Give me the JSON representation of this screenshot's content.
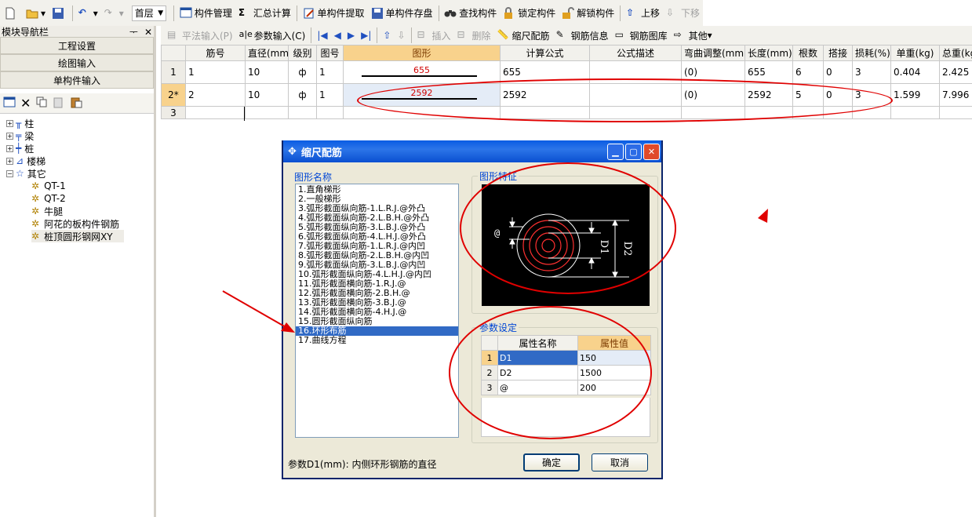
{
  "toolbar": {
    "floor": "首层",
    "items": [
      "构件管理",
      "汇总计算",
      "单构件提取",
      "单构件存盘",
      "查找构件",
      "锁定构件",
      "解锁构件",
      "上移",
      "下移"
    ]
  },
  "sidebar": {
    "title": "模块导航栏",
    "pin": "ᅮ",
    "close": "✕",
    "buttons": [
      "工程设置",
      "绘图输入",
      "单构件输入"
    ],
    "tree": [
      "柱",
      "梁",
      "桩",
      "楼梯",
      "其它"
    ],
    "children": [
      "QT-1",
      "QT-2",
      "牛腿",
      "阿花的板构件钢筋",
      "桩顶圆形钢网XY"
    ]
  },
  "subtoolbar": {
    "items": [
      "平法输入(P)",
      "参数输入(C)",
      "插入",
      "删除",
      "缩尺配筋",
      "钢筋信息",
      "钢筋图库",
      "其他"
    ]
  },
  "grid": {
    "headers": [
      "筋号",
      "直径(mm)",
      "级别",
      "图号",
      "图形",
      "计算公式",
      "公式描述",
      "弯曲调整(mm)",
      "长度(mm)",
      "根数",
      "搭接",
      "损耗(%)",
      "单重(kg)",
      "总重(kg"
    ],
    "rows": [
      {
        "rn": "1",
        "no": "1",
        "dia": "10",
        "grade": "ф",
        "fig": "1",
        "shape": "655",
        "formula": "655",
        "desc": "",
        "bend": "(0)",
        "len": "655",
        "count": "6",
        "lap": "0",
        "loss": "3",
        "unit": "0.404",
        "total": "2.425"
      },
      {
        "rn": "2*",
        "no": "2",
        "dia": "10",
        "grade": "ф",
        "fig": "1",
        "shape": "2592",
        "formula": "2592",
        "desc": "",
        "bend": "(0)",
        "len": "2592",
        "count": "5",
        "lap": "0",
        "loss": "3",
        "unit": "1.599",
        "total": "7.996"
      },
      {
        "rn": "3",
        "no": "",
        "dia": "",
        "grade": "",
        "fig": "",
        "shape": "",
        "formula": "",
        "desc": "",
        "bend": "",
        "len": "",
        "count": "",
        "lap": "",
        "loss": "",
        "unit": "",
        "total": ""
      }
    ]
  },
  "dialog": {
    "title": "缩尺配筋",
    "shape_list_label": "图形名称",
    "shapes": [
      "1.直角梯形",
      "2.一般梯形",
      "3.弧形截面纵向筋-1.L.R.J.@外凸",
      "4.弧形截面纵向筋-2.L.B.H.@外凸",
      "5.弧形截面纵向筋-3.L.B.J.@外凸",
      "6.弧形截面纵向筋-4.L.H.J.@外凸",
      "7.弧形截面纵向筋-1.L.R.J.@内凹",
      "8.弧形截面纵向筋-2.L.B.H.@内凹",
      "9.弧形截面纵向筋-3.L.B.J.@内凹",
      "10.弧形截面纵向筋-4.L.H.J.@内凹",
      "11.弧形截面横向筋-1.R.J.@",
      "12.弧形截面横向筋-2.B.H.@",
      "13.弧形截面横向筋-3.B.J.@",
      "14.弧形截面横向筋-4.H.J.@",
      "15.圆形截面纵向筋",
      "16.环形布筋",
      "17.曲线方程"
    ],
    "selected_index": 15,
    "feature_label": "图形特征",
    "figure": {
      "at": "@",
      "d1": "D1",
      "d2": "D2"
    },
    "param_label": "参数设定",
    "param_headers": [
      "属性名称",
      "属性值"
    ],
    "params": [
      {
        "rn": "1",
        "name": "D1",
        "value": "150"
      },
      {
        "rn": "2",
        "name": "D2",
        "value": "1500"
      },
      {
        "rn": "3",
        "name": "@",
        "value": "200"
      }
    ],
    "hint": "参数D1(mm): 内侧环形钢筋的直径",
    "ok": "确定",
    "cancel": "取消"
  }
}
